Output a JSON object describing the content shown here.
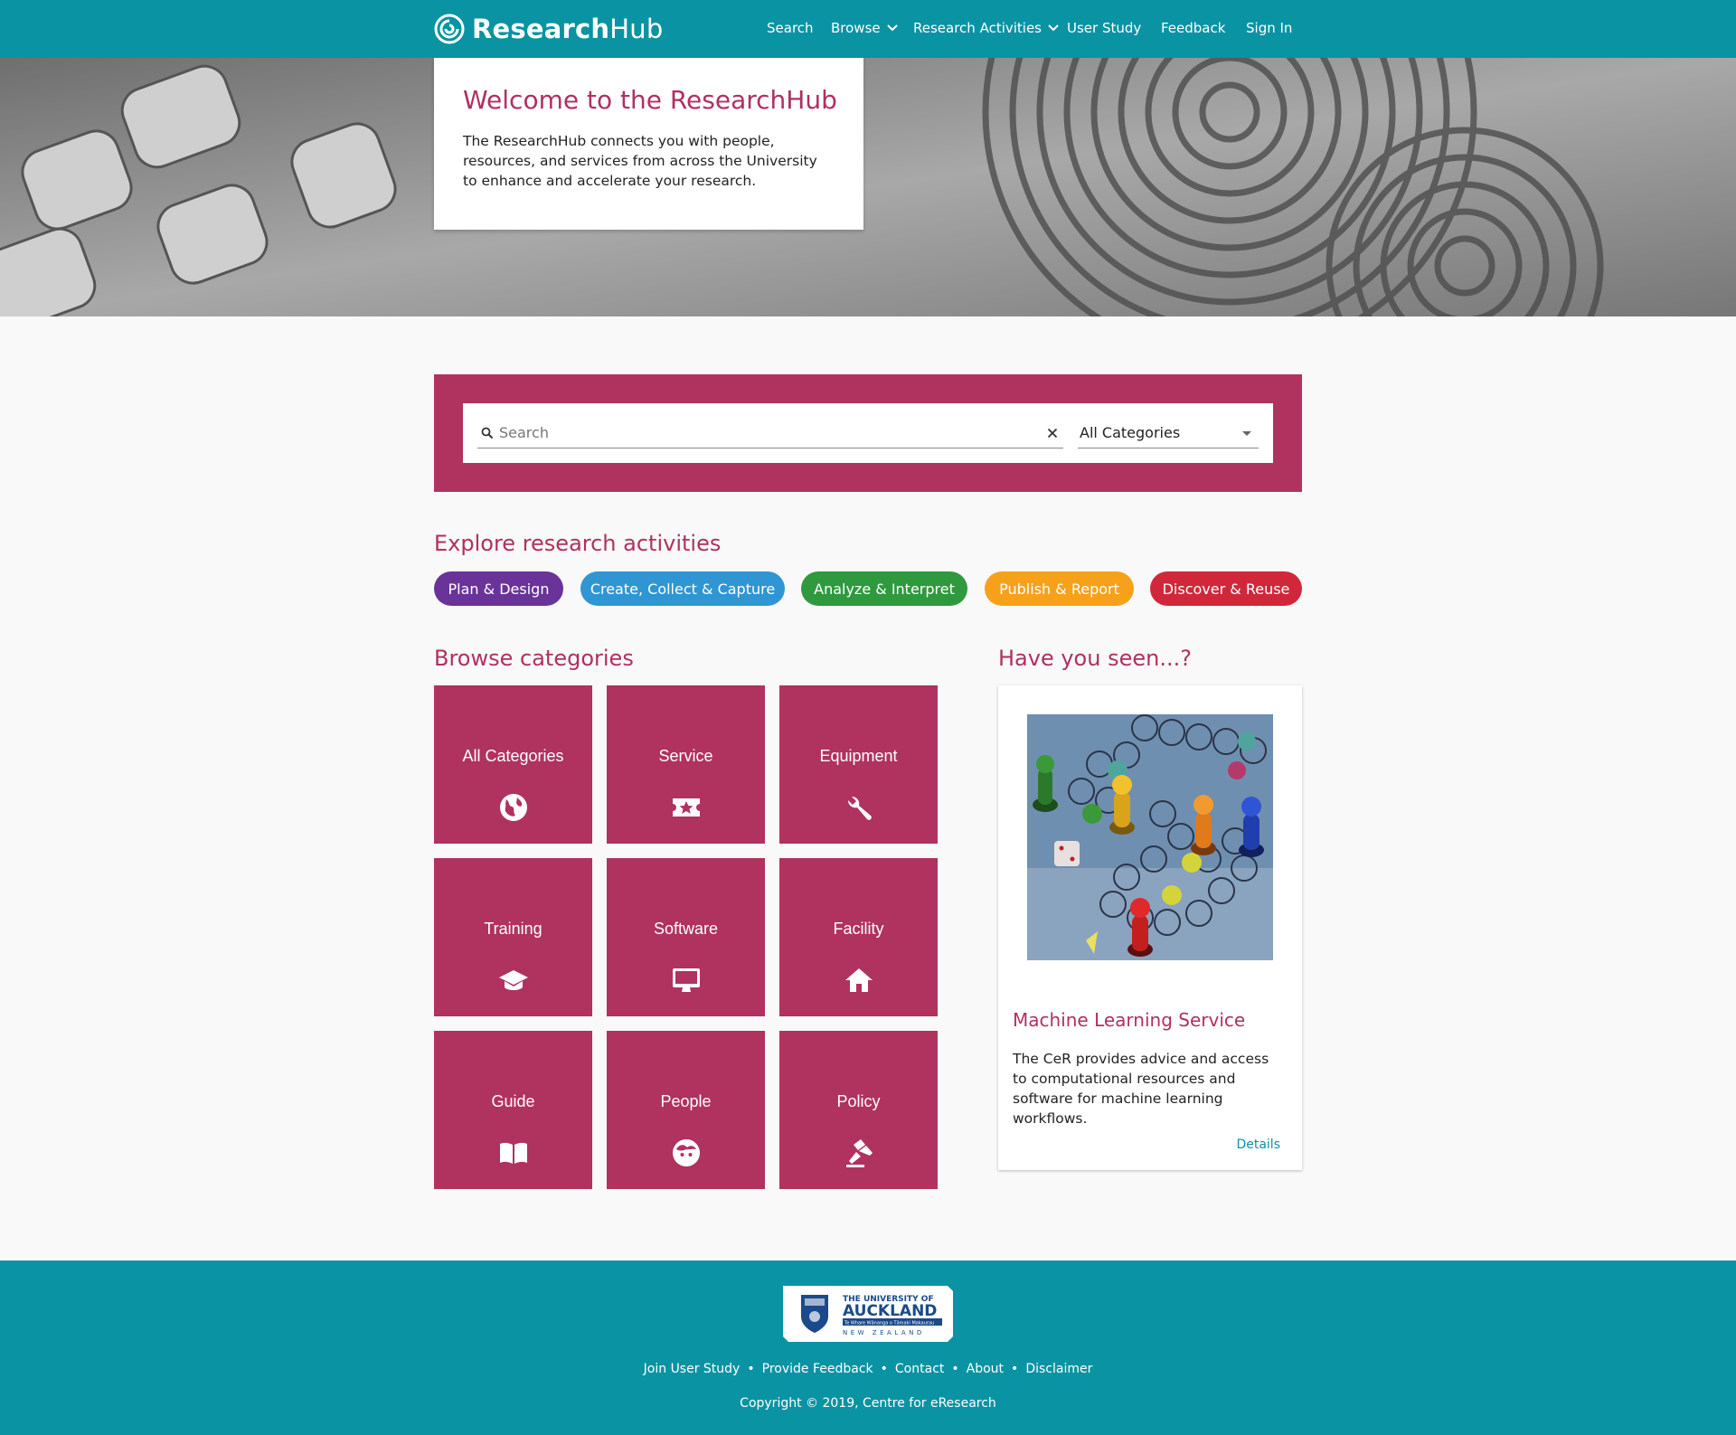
{
  "header": {
    "brand_bold": "Research",
    "brand_light": "Hub",
    "nav": [
      "Search",
      "Browse",
      "Research Activities",
      "User Study",
      "Feedback",
      "Sign In"
    ]
  },
  "hero": {
    "title": "Welcome to the ResearchHub",
    "text": "The ResearchHub connects you with people, resources, and services from across the University to enhance and accelerate your research."
  },
  "search": {
    "placeholder": "Search",
    "category_selected": "All Categories"
  },
  "activities": {
    "title": "Explore research activities",
    "items": [
      {
        "label": "Plan & Design",
        "color": "#6a3399"
      },
      {
        "label": "Create, Collect & Capture",
        "color": "#2f96d3"
      },
      {
        "label": "Analyze & Interpret",
        "color": "#2e9a3d"
      },
      {
        "label": "Publish & Report",
        "color": "#f7a11a"
      },
      {
        "label": "Discover & Reuse",
        "color": "#d0283a"
      }
    ]
  },
  "browse": {
    "title": "Browse categories",
    "tiles": [
      {
        "label": "All Categories",
        "icon": "globe-icon"
      },
      {
        "label": "Service",
        "icon": "ticket-star-icon"
      },
      {
        "label": "Equipment",
        "icon": "wrench-icon"
      },
      {
        "label": "Training",
        "icon": "graduation-cap-icon"
      },
      {
        "label": "Software",
        "icon": "monitor-icon"
      },
      {
        "label": "Facility",
        "icon": "home-icon"
      },
      {
        "label": "Guide",
        "icon": "book-icon"
      },
      {
        "label": "People",
        "icon": "face-icon"
      },
      {
        "label": "Policy",
        "icon": "gavel-icon"
      }
    ]
  },
  "seen": {
    "title": "Have you seen...?",
    "card_title": "Machine Learning Service",
    "card_text": "The CeR provides advice and access to computational resources and software for machine learning workflows.",
    "details": "Details"
  },
  "footer": {
    "logo_line1": "THE UNIVERSITY OF",
    "logo_line2": "AUCKLAND",
    "logo_line3": "Te Whare Wānanga o Tāmaki Makaurau",
    "logo_line4": "NEW ZEALAND",
    "links": [
      "Join User Study",
      "Provide Feedback",
      "Contact",
      "About",
      "Disclaimer"
    ],
    "copyright": "Copyright © 2019, Centre for eResearch"
  },
  "colors": {
    "teal": "#0a93a3",
    "magenta": "#b0325e"
  }
}
